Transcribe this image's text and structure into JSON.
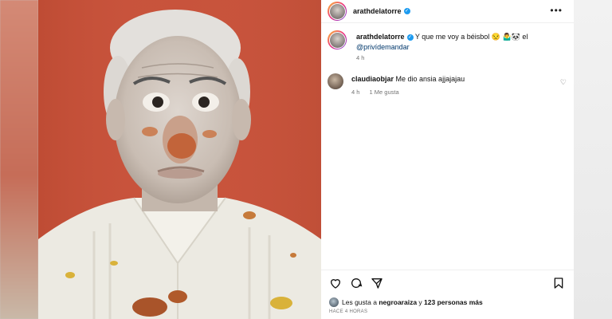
{
  "post": {
    "username": "arathdelatorre",
    "more_label": "•••",
    "caption": {
      "text": "Y que me voy a béisbol 😒 🤷‍♂️🐼 el",
      "mention": "@privídemandar",
      "time": "4 h"
    },
    "comments": [
      {
        "username": "claudiaobjar",
        "text": "Me dio ansia ajjajajau",
        "time": "4 h",
        "likes": "1 Me gusta"
      }
    ],
    "likes": {
      "prefix": "Les gusta a",
      "user": "negroaraiza",
      "connector": "y",
      "others": "123 personas más"
    },
    "posted_ago": "HACE 4 HORAS"
  },
  "colors": {
    "background_wall": "#c8533c",
    "verified": "#1d9bf0",
    "mention": "#00376b"
  },
  "icons": [
    "heart-icon",
    "comment-icon",
    "share-icon",
    "bookmark-icon",
    "more-icon",
    "verified-icon"
  ]
}
